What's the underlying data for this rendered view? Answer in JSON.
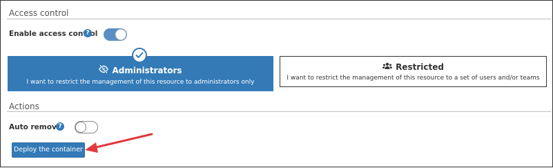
{
  "access_control": {
    "section_title": "Access control",
    "enable_label": "Enable access control",
    "enable_help_glyph": "?",
    "enabled": true
  },
  "ownership_options": [
    {
      "id": "administrators",
      "icon": "eye-slash-icon",
      "title": "Administrators",
      "description": "I want to restrict the management of this resource to administrators only",
      "selected": true
    },
    {
      "id": "restricted",
      "icon": "users-icon",
      "title": "Restricted",
      "description": "I want to restrict the management of this resource to a set of users and/or teams",
      "selected": false
    }
  ],
  "actions": {
    "section_title": "Actions",
    "auto_remove_label": "Auto remove",
    "auto_remove_help_glyph": "?",
    "auto_remove": false,
    "deploy_button_label": "Deploy the container"
  },
  "colors": {
    "primary": "#337ab7",
    "toggle_on": "#5b8fc3",
    "annotation_arrow": "#e0393e"
  }
}
